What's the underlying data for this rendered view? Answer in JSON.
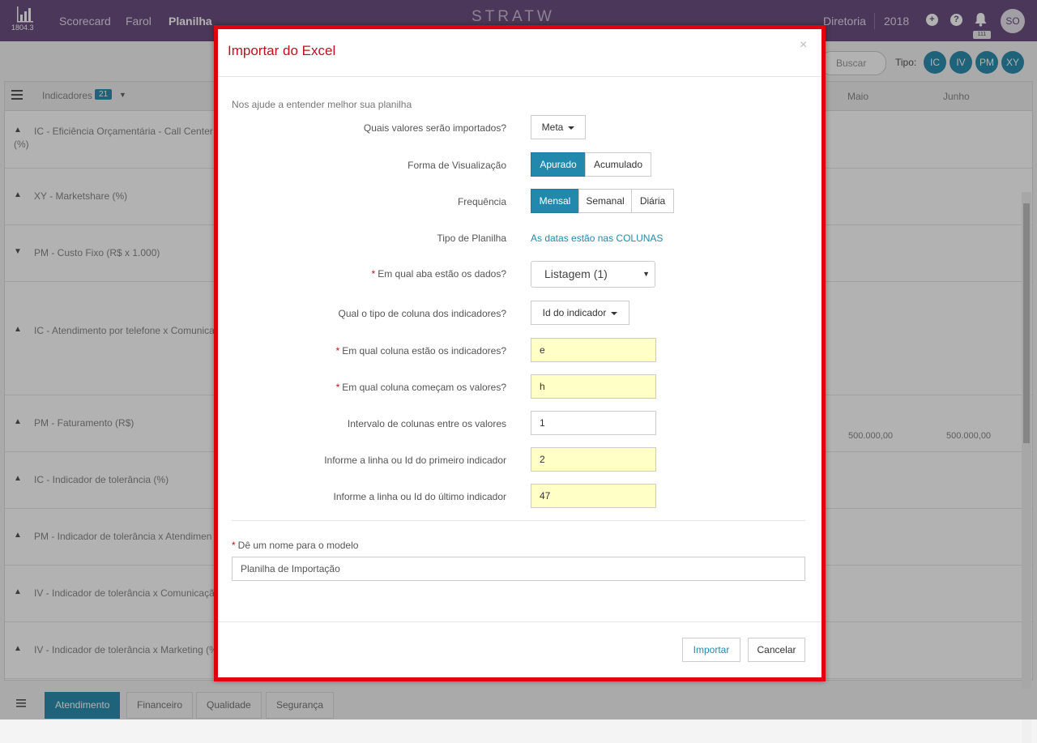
{
  "topbar": {
    "logo_version": "1804.3",
    "nav": [
      "Scorecard",
      "Farol",
      "Planilha"
    ],
    "brand": "STRATW",
    "company": "Diretoria",
    "year": "2018",
    "notification_count": "111",
    "avatar_initials": "SO",
    "colors": {
      "bar": "#6b4f80"
    }
  },
  "toolbar": {
    "search_placeholder": "Buscar",
    "tipo_label": "Tipo:",
    "tipo_chips": [
      "IC",
      "IV",
      "PM",
      "XY"
    ]
  },
  "grid": {
    "indicators_label": "Indicadores",
    "indicators_count": "21",
    "columns": [
      "Maio",
      "Junho"
    ],
    "rows": [
      {
        "label": "IC - Eficiência Orçamentária - Call Center (",
        "label_line2": "(%)",
        "expanded": false
      },
      {
        "label": "XY - Marketshare (%)",
        "expanded": false
      },
      {
        "label": "PM - Custo Fixo (R$ x 1.000)",
        "expanded": true
      },
      {
        "label": "IC - Atendimento por telefone x Comunica",
        "expanded": false
      },
      {
        "label": "PM - Faturamento (R$)",
        "expanded": false,
        "values": [
          "500.000,00",
          "500.000,00"
        ]
      },
      {
        "label": "IC - Indicador de tolerância (%)",
        "expanded": false
      },
      {
        "label": "PM - Indicador de tolerância x Atendimen",
        "expanded": false
      },
      {
        "label": "IV - Indicador de tolerância x Comunicaçã",
        "expanded": false
      },
      {
        "label": "IV - Indicador de tolerância x Marketing (%",
        "expanded": false
      }
    ]
  },
  "bottom_tabs": [
    "Atendimento",
    "Financeiro",
    "Qualidade",
    "Segurança"
  ],
  "modal": {
    "title": "Importar do Excel",
    "close": "×",
    "subtitle": "Nos ajude a entender melhor sua planilha",
    "fields": {
      "values_label": "Quais valores serão importados?",
      "values_selected": "Meta",
      "view_label": "Forma de Visualização",
      "view_options": [
        "Apurado",
        "Acumulado"
      ],
      "view_selected": "Apurado",
      "freq_label": "Frequência",
      "freq_options": [
        "Mensal",
        "Semanal",
        "Diária"
      ],
      "freq_selected": "Mensal",
      "sheet_type_label": "Tipo de Planilha",
      "sheet_type_link": "As datas estão nas COLUNAS",
      "tab_label": "Em qual aba estão os dados?",
      "tab_selected": "Listagem (1)",
      "col_type_label": "Qual o tipo de coluna dos indicadores?",
      "col_type_selected": "Id do indicador",
      "ind_col_label": "Em qual coluna estão os indicadores?",
      "ind_col_value": "e",
      "val_col_label": "Em qual coluna começam os valores?",
      "val_col_value": "h",
      "interval_label": "Intervalo de colunas entre os valores",
      "interval_value": "1",
      "first_label": "Informe a linha ou Id do primeiro indicador",
      "first_value": "2",
      "last_label": "Informe a linha ou Id do último indicador",
      "last_value": "47",
      "model_name_label": "Dê um nome para o modelo",
      "model_name_value": "Planilha de Importação"
    },
    "buttons": {
      "import": "Importar",
      "cancel": "Cancelar"
    },
    "required_mark": "*",
    "colors": {
      "border": "#e00010",
      "title": "#c0101d",
      "primary": "#2389ac",
      "highlight": "#ffffc6"
    }
  }
}
